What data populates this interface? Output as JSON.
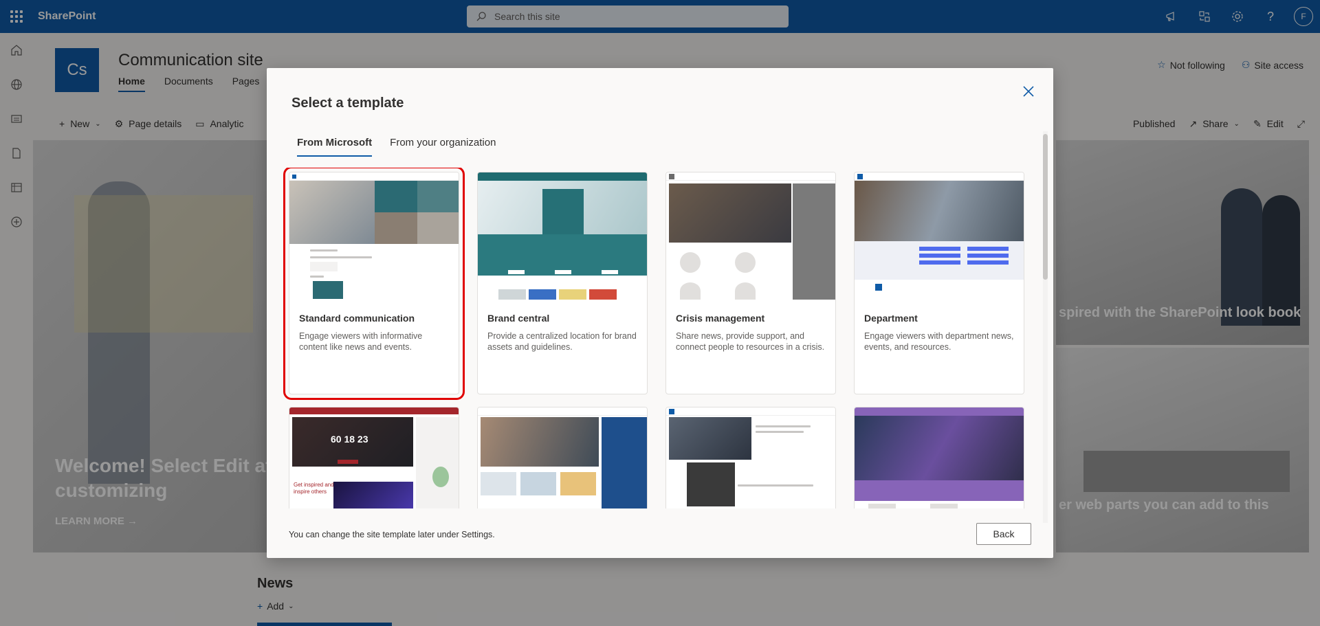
{
  "suitebar": {
    "app_name": "SharePoint",
    "search_placeholder": "Search this site",
    "avatar_initial": "F"
  },
  "site": {
    "logo_text": "Cs",
    "title": "Communication site",
    "nav": [
      "Home",
      "Documents",
      "Pages"
    ],
    "not_following": "Not following",
    "site_access": "Site access"
  },
  "commandbar": {
    "new": "New",
    "page_details": "Page details",
    "analytics": "Analytic",
    "published": "Published",
    "share": "Share",
    "edit": "Edit"
  },
  "hero": {
    "headline": "Welcome! Select Edit at t customizing",
    "learn_more": "LEARN MORE →",
    "tile1": "spired with the SharePoint look book",
    "tile2": "er web parts you can add to this"
  },
  "news": {
    "title": "News",
    "add": "Add"
  },
  "modal": {
    "title": "Select a template",
    "tabs": [
      "From Microsoft",
      "From your organization"
    ],
    "footer_note": "You can change the site template later under Settings.",
    "back": "Back",
    "templates": [
      {
        "title": "Standard communication",
        "description": "Engage viewers with informative content like news and events."
      },
      {
        "title": "Brand central",
        "description": "Provide a centralized location for brand assets and guidelines."
      },
      {
        "title": "Crisis management",
        "description": "Share news, provide support, and connect people to resources in a crisis."
      },
      {
        "title": "Department",
        "description": "Engage viewers with department news, events, and resources."
      }
    ],
    "thumb_text": {
      "countdown": "60 18 23",
      "inspired": "Get inspired and inspire others"
    }
  },
  "colors": {
    "brand": "#0f5ba7",
    "selection": "#e00000"
  }
}
